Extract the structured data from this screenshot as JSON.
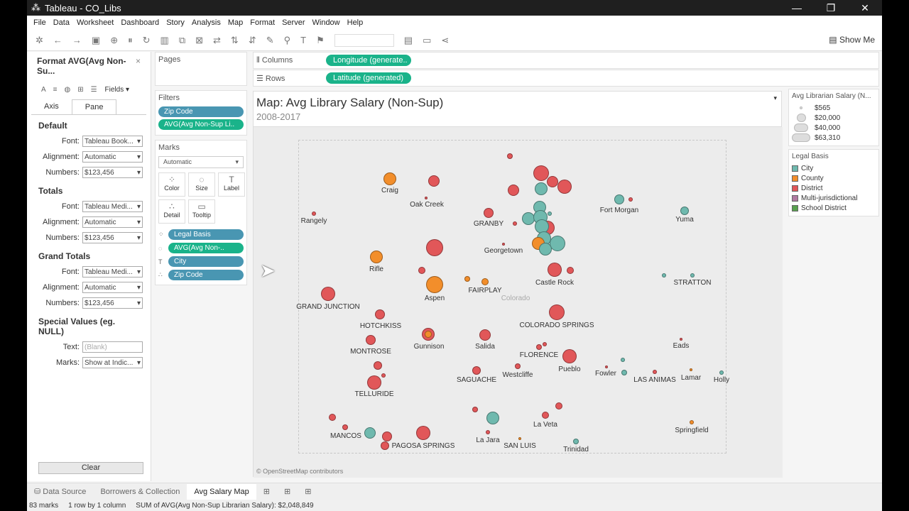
{
  "window": {
    "title": "Tableau - CO_Libs",
    "app_icon": "tableau-logo-icon"
  },
  "menu": [
    "File",
    "Data",
    "Worksheet",
    "Dashboard",
    "Story",
    "Analysis",
    "Map",
    "Format",
    "Server",
    "Window",
    "Help"
  ],
  "toolbar": {
    "show_me": "Show Me"
  },
  "format_pane": {
    "title": "Format AVG(Avg Non-Su...",
    "close": "×",
    "fields": "Fields ▾",
    "tabs": [
      "Axis",
      "Pane"
    ],
    "default": {
      "heading": "Default",
      "font_label": "Font:",
      "font": "Tableau Book...",
      "align_label": "Alignment:",
      "align": "Automatic",
      "num_label": "Numbers:",
      "num": "$123,456"
    },
    "totals": {
      "heading": "Totals",
      "font_label": "Font:",
      "font": "Tableau Medi...",
      "align_label": "Alignment:",
      "align": "Automatic",
      "num_label": "Numbers:",
      "num": "$123,456"
    },
    "grand": {
      "heading": "Grand Totals",
      "font_label": "Font:",
      "font": "Tableau Medi...",
      "align_label": "Alignment:",
      "align": "Automatic",
      "num_label": "Numbers:",
      "num": "$123,456"
    },
    "special": {
      "heading": "Special Values (eg. NULL)",
      "text_label": "Text:",
      "text_placeholder": "(Blank)",
      "marks_label": "Marks:",
      "marks": "Show at Indic..."
    },
    "clear": "Clear"
  },
  "pages": "Pages",
  "filters": {
    "title": "Filters",
    "items": [
      "Zip Code",
      "AVG(Avg Non-Sup Li.."
    ]
  },
  "marks": {
    "title": "Marks",
    "type": "Automatic",
    "buttons": [
      "Color",
      "Size",
      "Label",
      "Detail",
      "Tooltip"
    ],
    "fields": [
      "Legal Basis",
      "AVG(Avg Non-..",
      "City",
      "Zip Code"
    ]
  },
  "shelves": {
    "columns_label": "Columns",
    "columns": "Longitude (generate..",
    "rows_label": "Rows",
    "rows": "Latitude (generated)"
  },
  "view": {
    "title": "Map: Avg Library Salary (Non-Sup)",
    "subtitle": "2008-2017",
    "credit": "© OpenStreetMap contributors",
    "state_label": "Colorado",
    "cities": [
      "Craig",
      "Oak Creek",
      "Rangely",
      "GRANBY",
      "Fort Morgan",
      "Yuma",
      "Georgetown",
      "Rifle",
      "FAIRPLAY",
      "Castle Rock",
      "STRATTON",
      "Aspen",
      "GRAND JUNCTION",
      "HOTCHKISS",
      "COLORADO SPRINGS",
      "Gunnison",
      "Salida",
      "MONTROSE",
      "FLORENCE",
      "Eads",
      "Pueblo",
      "Fowler",
      "Westcliffe",
      "SAGUACHE",
      "LAS ANIMAS",
      "Lamar",
      "Holly",
      "TELLURIDE",
      "La Veta",
      "Springfield",
      "MANCOS",
      "PAGOSA SPRINGS",
      "La Jara",
      "SAN LUIS",
      "Trinidad"
    ]
  },
  "size_legend": {
    "title": "Avg Librarian Salary (N...",
    "items": [
      "$565",
      "$20,000",
      "$40,000",
      "$63,310"
    ]
  },
  "color_legend": {
    "title": "Legal Basis",
    "items": [
      {
        "label": "City",
        "color": "#6fb9ae"
      },
      {
        "label": "County",
        "color": "#f28e2b"
      },
      {
        "label": "District",
        "color": "#e15759"
      },
      {
        "label": "Multi-jurisdictional",
        "color": "#b07aa1"
      },
      {
        "label": "School District",
        "color": "#59a14f"
      }
    ]
  },
  "sheet_tabs": [
    "Data Source",
    "Borrowers & Collection",
    "Avg Salary Map"
  ],
  "status": [
    "83 marks",
    "1 row by 1 column",
    "SUM of AVG(Avg Non-Sup Librarian Salary): $2,048,849"
  ]
}
